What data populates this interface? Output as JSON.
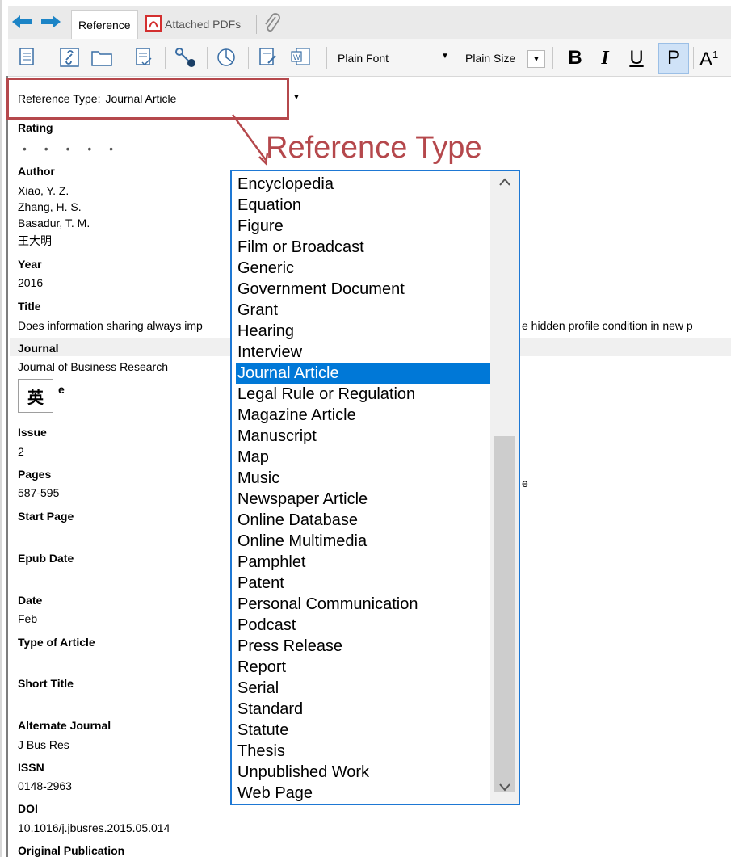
{
  "tabs": {
    "reference": "Reference",
    "attached_pdfs": "Attached PDFs"
  },
  "toolbar": {
    "font": "Plain Font",
    "size": "Plain Size",
    "bold": "B",
    "italic": "I",
    "underline": "U",
    "plain": "P",
    "superscript": "A",
    "superscript_digit": "1"
  },
  "reference_type": {
    "label": "Reference Type:",
    "value": "Journal Article"
  },
  "callout": "Reference Type",
  "rating": {
    "label": "Rating",
    "dots": "• • • • •"
  },
  "fields": {
    "author_label": "Author",
    "authors": [
      "Xiao, Y. Z.",
      "Zhang, H. S.",
      "Basadur, T. M.",
      "王大明"
    ],
    "year_label": "Year",
    "year": "2016",
    "title_label": "Title",
    "title_start": "Does information sharing always imp",
    "title_end": "e hidden profile condition in new p",
    "journal_label": "Journal",
    "journal": "Journal of Business Research",
    "volume_label_partial": "e",
    "issue_label": "Issue",
    "issue": "2",
    "pages_label": "Pages",
    "pages": "587-595",
    "pages_fragment": "e",
    "start_page_label": "Start Page",
    "epub_date_label": "Epub Date",
    "date_label": "Date",
    "date": "Feb",
    "type_of_article_label": "Type of Article",
    "short_title_label": "Short Title",
    "alt_journal_label": "Alternate Journal",
    "alt_journal": "J Bus Res",
    "issn_label": "ISSN",
    "issn": "0148-2963",
    "doi_label": "DOI",
    "doi": "10.1016/j.jbusres.2015.05.014",
    "orig_pub_label": "Original Publication"
  },
  "ime_badge": "英",
  "dropdown": {
    "options": [
      "Encyclopedia",
      "Equation",
      "Figure",
      "Film or Broadcast",
      "Generic",
      "Government Document",
      "Grant",
      "Hearing",
      "Interview",
      "Journal Article",
      "Legal Rule or Regulation",
      "Magazine Article",
      "Manuscript",
      "Map",
      "Music",
      "Newspaper Article",
      "Online Database",
      "Online Multimedia",
      "Pamphlet",
      "Patent",
      "Personal Communication",
      "Podcast",
      "Press Release",
      "Report",
      "Serial",
      "Standard",
      "Statute",
      "Thesis",
      "Unpublished Work",
      "Web Page"
    ],
    "selected": "Journal Article"
  },
  "colors": {
    "accent_red": "#b5484c",
    "selection_blue": "#0078d7",
    "dropdown_border": "#1e78d4",
    "nav_arrow": "#1c84c6"
  }
}
